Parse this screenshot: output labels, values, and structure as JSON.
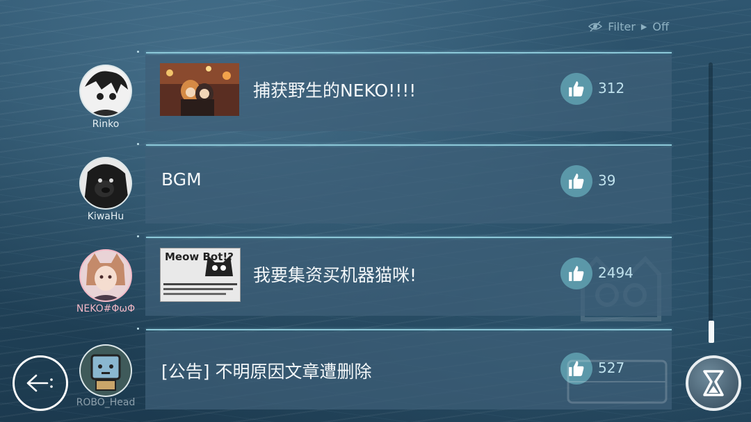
{
  "filter": {
    "label": "Filter",
    "value": "Off"
  },
  "posts": [
    {
      "author": "Rinko",
      "title": "捕获野生的NEKO!!!!",
      "likes": "312",
      "has_thumbnail": true
    },
    {
      "author": "KiwaHu",
      "title": "BGM",
      "likes": "39",
      "has_thumbnail": false
    },
    {
      "author": "NEKO#ΦωΦ",
      "title": "我要集资买机器猫咪!",
      "likes": "2494",
      "has_thumbnail": true,
      "thumbnail_text": "Meow Bot!?"
    },
    {
      "author": "ROBO_Head",
      "title": "[公告] 不明原因文章遭删除",
      "likes": "527",
      "has_thumbnail": false
    }
  ],
  "colors": {
    "accent_line": "#8cc8d8",
    "like_button": "#5b98a9",
    "neko_name": "#f2b8c6"
  },
  "icons": {
    "filter": "eye-slash-icon",
    "like": "thumbs-up-icon",
    "back": "back-arrow-icon",
    "menu": "hourglass-logo-icon"
  }
}
